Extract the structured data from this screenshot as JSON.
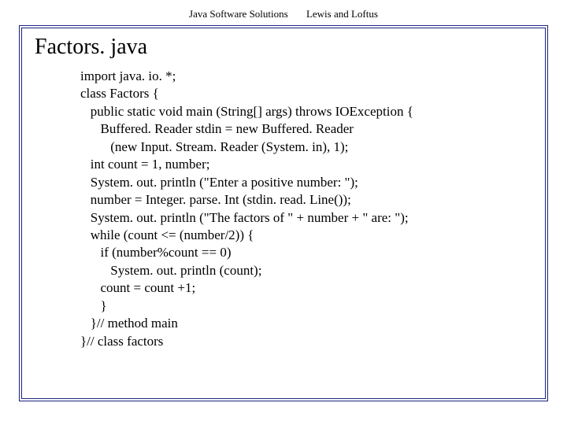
{
  "header": {
    "left": "Java Software Solutions",
    "right": "Lewis and Loftus"
  },
  "title": "Factors. java",
  "code": {
    "l1": "import java. io. *;",
    "l2": "class Factors {",
    "l3": "   public static void main (String[] args) throws IOException {",
    "l4": "      Buffered. Reader stdin = new Buffered. Reader",
    "l5": "         (new Input. Stream. Reader (System. in), 1);",
    "l6": "   int count = 1, number;",
    "l7": "   System. out. println (\"Enter a positive number: \");",
    "l8": "   number = Integer. parse. Int (stdin. read. Line());",
    "l9": "   System. out. println (\"The factors of \" + number + \" are: \");",
    "l10": "   while (count <= (number/2)) {",
    "l11": "      if (number%count == 0)",
    "l12": "         System. out. println (count);",
    "l13": "      count = count +1;",
    "l14": "      }",
    "l15": "   }// method main",
    "l16": "}// class factors"
  }
}
